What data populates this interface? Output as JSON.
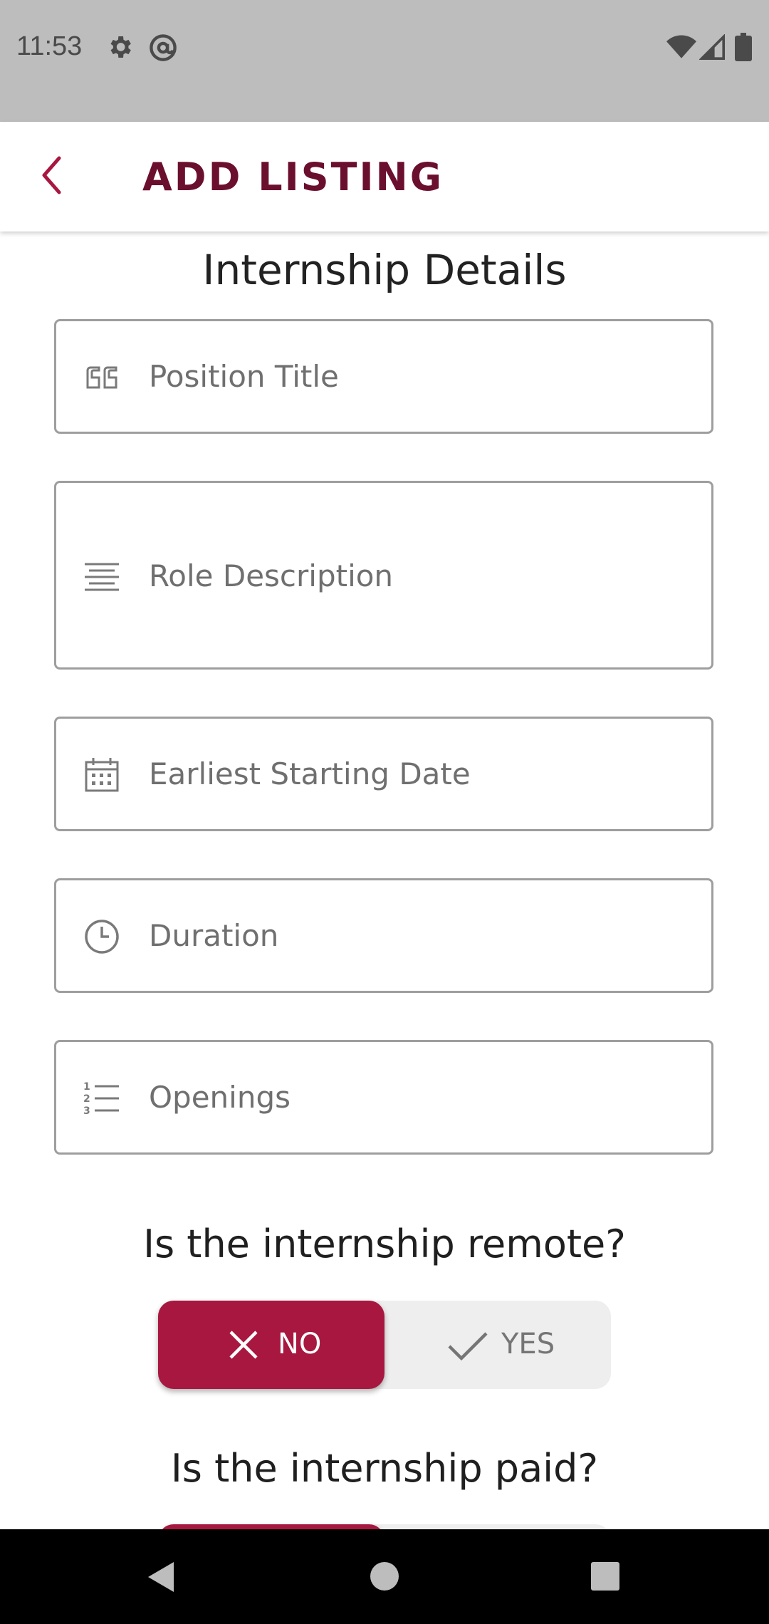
{
  "status_bar": {
    "time": "11:53",
    "icons": [
      "gear-icon",
      "at-sign-icon",
      "wifi-icon",
      "signal-icon",
      "battery-icon"
    ]
  },
  "app_bar": {
    "title": "ADD LISTING",
    "back_icon": "chevron-left-icon",
    "accent_color": "#a8173f",
    "title_color": "#6b0f2f"
  },
  "form": {
    "section_title": "Internship Details",
    "fields": [
      {
        "icon": "quote-icon",
        "placeholder": "Position Title"
      },
      {
        "icon": "text-align-icon",
        "placeholder": "Role Description"
      },
      {
        "icon": "calendar-icon",
        "placeholder": "Earliest Starting Date"
      },
      {
        "icon": "clock-icon",
        "placeholder": "Duration"
      },
      {
        "icon": "numbered-list-icon",
        "placeholder": "Openings"
      }
    ]
  },
  "remote_question": {
    "label": "Is the internship remote?",
    "no_label": "NO",
    "yes_label": "YES",
    "selected": "NO"
  },
  "paid_question": {
    "label": "Is the internship paid?",
    "selected": "NO"
  },
  "nav_bar": {
    "icons": [
      "back-triangle-icon",
      "home-circle-icon",
      "recents-square-icon"
    ]
  }
}
